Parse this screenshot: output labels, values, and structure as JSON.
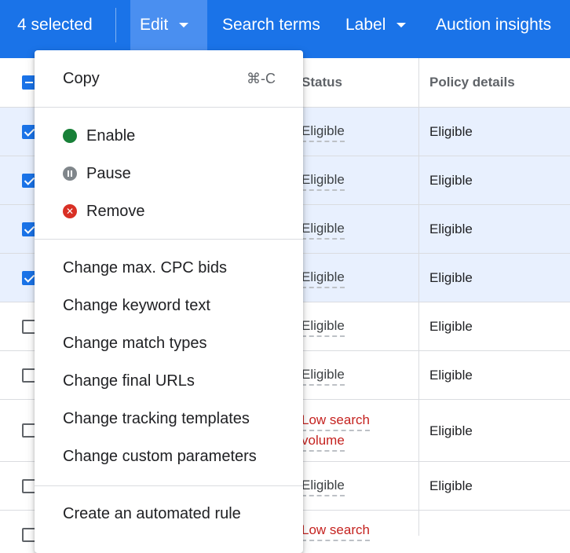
{
  "toolbar": {
    "selected_count": "4 selected",
    "edit": "Edit",
    "search_terms": "Search terms",
    "label": "Label",
    "auction_insights": "Auction insights"
  },
  "table": {
    "headers": {
      "status": "Status",
      "policy": "Policy details"
    },
    "rows": [
      {
        "checked": true,
        "status": "Eligible",
        "policy": "Eligible"
      },
      {
        "checked": true,
        "status": "Eligible",
        "policy": "Eligible"
      },
      {
        "checked": true,
        "status": "Eligible",
        "policy": "Eligible"
      },
      {
        "checked": true,
        "status": "Eligible",
        "policy": "Eligible"
      },
      {
        "checked": false,
        "status": "Eligible",
        "policy": "Eligible"
      },
      {
        "checked": false,
        "status": "Eligible",
        "policy": "Eligible"
      },
      {
        "checked": false,
        "status": [
          "Low search",
          "volume"
        ],
        "policy": "Eligible",
        "warning": true
      },
      {
        "checked": false,
        "status": "Eligible",
        "policy": "Eligible"
      },
      {
        "checked": false,
        "status": [
          "Low search"
        ],
        "policy": "",
        "warning": true
      }
    ]
  },
  "menu": {
    "copy": "Copy",
    "copy_shortcut": "⌘-C",
    "enable": "Enable",
    "pause": "Pause",
    "remove": "Remove",
    "change_max_cpc": "Change max. CPC bids",
    "change_keyword_text": "Change keyword text",
    "change_match_types": "Change match types",
    "change_final_urls": "Change final URLs",
    "change_tracking_templates": "Change tracking templates",
    "change_custom_parameters": "Change custom parameters",
    "create_automated_rule": "Create an automated rule"
  },
  "colors": {
    "toolbar_bg": "#1a73e8",
    "selected_row_bg": "#e8f0fe",
    "enable": "#188038",
    "pause": "#80868b",
    "remove": "#d93025",
    "warning_text": "#c5221f"
  }
}
